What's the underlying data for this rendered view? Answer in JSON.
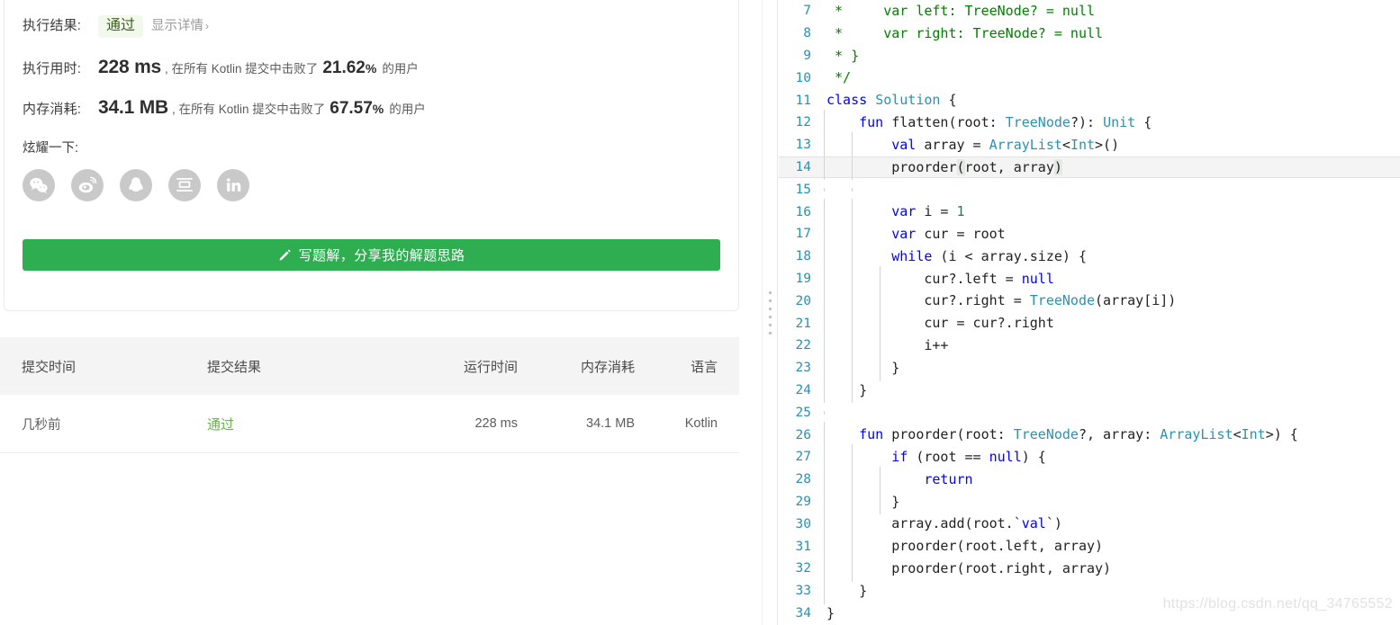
{
  "result": {
    "result_label": "执行结果:",
    "verdict": "通过",
    "detail_link": "显示详情",
    "detail_chevron": "›",
    "runtime_label": "执行用时:",
    "runtime_value": "228 ms",
    "runtime_text_before": ", 在所有 Kotlin 提交中击败了",
    "runtime_percent": "21.62",
    "percent_symbol": "%",
    "runtime_text_after": "的用户",
    "memory_label": "内存消耗:",
    "memory_value": "34.1 MB",
    "memory_text_before": ", 在所有 Kotlin 提交中击败了",
    "memory_percent": "67.57",
    "memory_text_after": "的用户"
  },
  "share": {
    "label": "炫耀一下:",
    "icons": [
      {
        "name": "wechat-icon",
        "title": "微信"
      },
      {
        "name": "weibo-icon",
        "title": "微博"
      },
      {
        "name": "qq-icon",
        "title": "QQ"
      },
      {
        "name": "douban-icon",
        "title": "豆瓣"
      },
      {
        "name": "linkedin-icon",
        "title": "LinkedIn"
      }
    ]
  },
  "write_button": {
    "label": "写题解，分享我的解题思路",
    "icon": "pencil-icon",
    "color": "#2ead51"
  },
  "submissions": {
    "headers": [
      "提交时间",
      "提交结果",
      "运行时间",
      "内存消耗",
      "语言"
    ],
    "rows": [
      {
        "time": "几秒前",
        "result": "通过",
        "runtime": "228 ms",
        "memory": "34.1 MB",
        "language": "Kotlin"
      }
    ],
    "pass_color": "#5bbd3d"
  },
  "editor": {
    "watermark": "https://blog.csdn.net/qq_34765552",
    "active_line": 14,
    "first_line": 7,
    "last_line": 34,
    "lines": [
      {
        "n": "7",
        "indents": 0,
        "tokens": [
          [
            "cm",
            " *     var left: TreeNode? = null"
          ]
        ]
      },
      {
        "n": "8",
        "indents": 0,
        "tokens": [
          [
            "cm",
            " *     var right: TreeNode? = null"
          ]
        ]
      },
      {
        "n": "9",
        "indents": 0,
        "tokens": [
          [
            "cm",
            " * }"
          ]
        ]
      },
      {
        "n": "10",
        "indents": 0,
        "tokens": [
          [
            "cm",
            " */"
          ]
        ]
      },
      {
        "n": "11",
        "indents": 0,
        "tokens": [
          [
            "kw",
            "class"
          ],
          [
            "tx",
            " "
          ],
          [
            "ty",
            "Solution"
          ],
          [
            "tx",
            " {"
          ]
        ]
      },
      {
        "n": "12",
        "indents": 1,
        "tokens": [
          [
            "tx",
            "    "
          ],
          [
            "kw",
            "fun"
          ],
          [
            "tx",
            " flatten(root: "
          ],
          [
            "ty",
            "TreeNode"
          ],
          [
            "tx",
            "?): "
          ],
          [
            "ty",
            "Unit"
          ],
          [
            "tx",
            " {"
          ]
        ]
      },
      {
        "n": "13",
        "indents": 2,
        "tokens": [
          [
            "tx",
            "        "
          ],
          [
            "kw",
            "val"
          ],
          [
            "tx",
            " array = "
          ],
          [
            "ty",
            "ArrayList"
          ],
          [
            "tx",
            "<"
          ],
          [
            "ty",
            "Int"
          ],
          [
            "tx",
            ">()"
          ]
        ]
      },
      {
        "n": "14",
        "indents": 2,
        "tokens": [
          [
            "tx",
            "        proorder"
          ],
          [
            "brk",
            "("
          ],
          [
            "tx",
            "root, array"
          ],
          [
            "brk",
            ")"
          ]
        ]
      },
      {
        "n": "15",
        "indents": 2,
        "tokens": []
      },
      {
        "n": "16",
        "indents": 2,
        "tokens": [
          [
            "tx",
            "        "
          ],
          [
            "kw",
            "var"
          ],
          [
            "tx",
            " i = "
          ],
          [
            "num",
            "1"
          ]
        ]
      },
      {
        "n": "17",
        "indents": 2,
        "tokens": [
          [
            "tx",
            "        "
          ],
          [
            "kw",
            "var"
          ],
          [
            "tx",
            " cur = root"
          ]
        ]
      },
      {
        "n": "18",
        "indents": 2,
        "tokens": [
          [
            "tx",
            "        "
          ],
          [
            "kw",
            "while"
          ],
          [
            "tx",
            " (i < array.size) {"
          ]
        ]
      },
      {
        "n": "19",
        "indents": 3,
        "tokens": [
          [
            "tx",
            "            cur?.left = "
          ],
          [
            "kw",
            "null"
          ]
        ]
      },
      {
        "n": "20",
        "indents": 3,
        "tokens": [
          [
            "tx",
            "            cur?.right = "
          ],
          [
            "ty",
            "TreeNode"
          ],
          [
            "tx",
            "(array[i])"
          ]
        ]
      },
      {
        "n": "21",
        "indents": 3,
        "tokens": [
          [
            "tx",
            "            cur = cur?.right"
          ]
        ]
      },
      {
        "n": "22",
        "indents": 3,
        "tokens": [
          [
            "tx",
            "            i++"
          ]
        ]
      },
      {
        "n": "23",
        "indents": 3,
        "tokens": [
          [
            "tx",
            "        }"
          ]
        ]
      },
      {
        "n": "24",
        "indents": 2,
        "tokens": [
          [
            "tx",
            "    }"
          ]
        ]
      },
      {
        "n": "25",
        "indents": 1,
        "tokens": []
      },
      {
        "n": "26",
        "indents": 1,
        "tokens": [
          [
            "tx",
            "    "
          ],
          [
            "kw",
            "fun"
          ],
          [
            "tx",
            " proorder(root: "
          ],
          [
            "ty",
            "TreeNode"
          ],
          [
            "tx",
            "?, array: "
          ],
          [
            "ty",
            "ArrayList"
          ],
          [
            "tx",
            "<"
          ],
          [
            "ty",
            "Int"
          ],
          [
            "tx",
            ">) {"
          ]
        ]
      },
      {
        "n": "27",
        "indents": 2,
        "tokens": [
          [
            "tx",
            "        "
          ],
          [
            "kw",
            "if"
          ],
          [
            "tx",
            " (root == "
          ],
          [
            "kw",
            "null"
          ],
          [
            "tx",
            ") {"
          ]
        ]
      },
      {
        "n": "28",
        "indents": 3,
        "tokens": [
          [
            "tx",
            "            "
          ],
          [
            "kw",
            "return"
          ]
        ]
      },
      {
        "n": "29",
        "indents": 3,
        "tokens": [
          [
            "tx",
            "        }"
          ]
        ]
      },
      {
        "n": "30",
        "indents": 2,
        "tokens": [
          [
            "tx",
            "        array.add(root.`"
          ],
          [
            "kw",
            "val"
          ],
          [
            "tx",
            "`)"
          ]
        ]
      },
      {
        "n": "31",
        "indents": 2,
        "tokens": [
          [
            "tx",
            "        proorder(root.left, array)"
          ]
        ]
      },
      {
        "n": "32",
        "indents": 2,
        "tokens": [
          [
            "tx",
            "        proorder(root.right, array)"
          ]
        ]
      },
      {
        "n": "33",
        "indents": 1,
        "tokens": [
          [
            "tx",
            "    }"
          ]
        ]
      },
      {
        "n": "34",
        "indents": 0,
        "tokens": [
          [
            "tx",
            "}"
          ]
        ]
      }
    ]
  }
}
